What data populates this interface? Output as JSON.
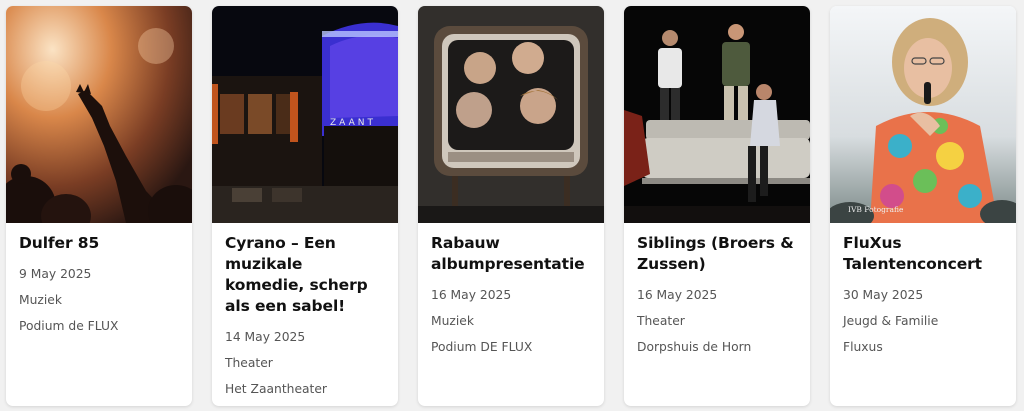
{
  "events": [
    {
      "title": "Dulfer 85",
      "date": "9 May 2025",
      "category": "Muziek",
      "venue": "Podium de FLUX"
    },
    {
      "title": "Cyrano – Een muzikale komedie, scherp als een sabel!",
      "date": "14 May 2025",
      "category": "Theater",
      "venue": "Het Zaantheater"
    },
    {
      "title": "Rabauw albumpresentatie",
      "date": "16 May 2025",
      "category": "Muziek",
      "venue": "Podium DE FLUX"
    },
    {
      "title": "Siblings (Broers & Zussen)",
      "date": "16 May 2025",
      "category": "Theater",
      "venue": "Dorpshuis de Horn"
    },
    {
      "title": "FluXus Talentenconcert",
      "date": "30 May 2025",
      "category": "Jeugd & Familie",
      "venue": "Fluxus",
      "image_credit": "IVB Fotografie"
    }
  ],
  "images": {
    "building_sign": "ZAANT"
  }
}
